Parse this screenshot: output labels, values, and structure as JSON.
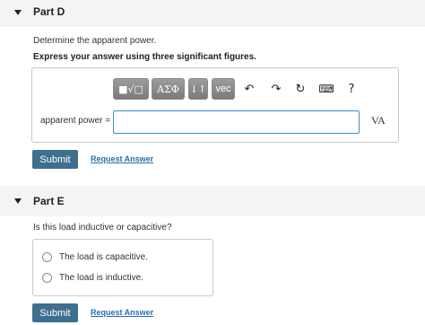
{
  "partD": {
    "title": "Part D",
    "question": "Determine the apparent power.",
    "instruction": "Express your answer using three significant figures.",
    "toolbar": {
      "templates_label": "■√□",
      "greek_label": "ΑΣΦ",
      "arrows_label": "↓↑",
      "vec_label": "vec",
      "undo_glyph": "↶",
      "redo_glyph": "↷",
      "reset_glyph": "↻",
      "keyboard_glyph": "⌨",
      "help_glyph": "?"
    },
    "answer_label": "apparent power =",
    "answer_value": "",
    "unit": "VA",
    "submit_label": "Submit",
    "request_answer_label": "Request Answer"
  },
  "partE": {
    "title": "Part E",
    "question": "Is this load inductive or capacitive?",
    "options": [
      "The load is capacitive.",
      "The load is inductive."
    ],
    "submit_label": "Submit",
    "request_answer_label": "Request Answer"
  }
}
